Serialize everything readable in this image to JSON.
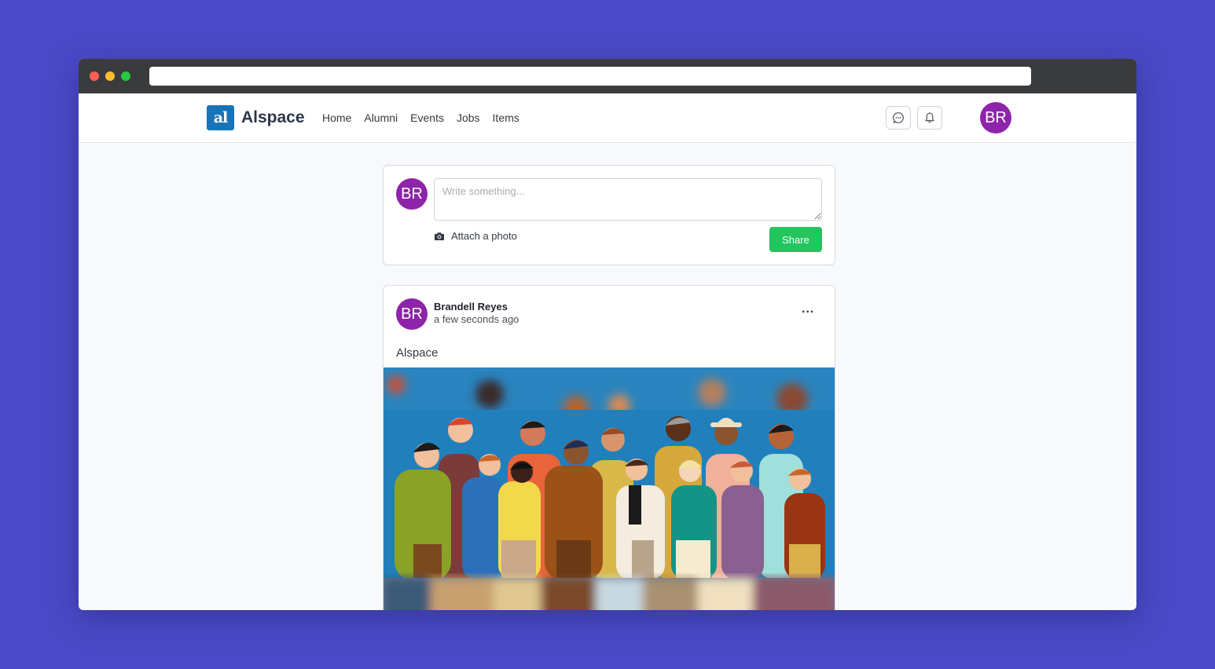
{
  "browser": {
    "url": ""
  },
  "navbar": {
    "logo_text": "al",
    "brand": "Alspace",
    "links": [
      "Home",
      "Alumni",
      "Events",
      "Jobs",
      "Items"
    ],
    "user_initials": "BR"
  },
  "composer": {
    "user_initials": "BR",
    "placeholder": "Write something...",
    "attach_label": "Attach a photo",
    "share_label": "Share"
  },
  "post": {
    "author_initials": "BR",
    "author": "Brandell Reyes",
    "time": "a few seconds ago",
    "more_label": "...",
    "text": "Alspace",
    "image_description_icon": "people-group-illustration"
  },
  "colors": {
    "background": "#4a4ac8",
    "brand": "#1874b8",
    "avatar": "#8e24aa",
    "share": "#22c55e"
  }
}
